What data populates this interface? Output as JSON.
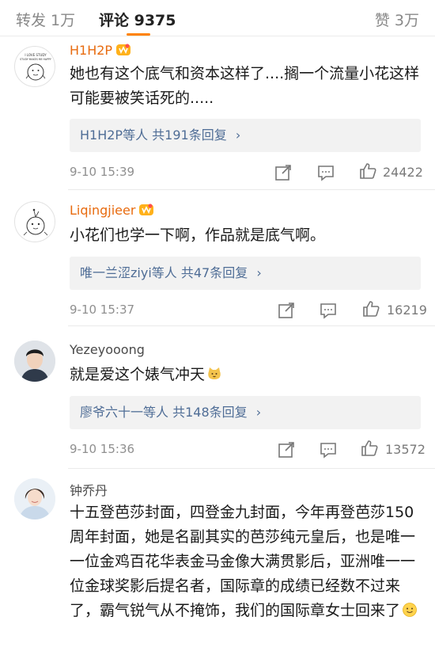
{
  "tabs": {
    "repost": "转发 1万",
    "comments": "评论 9375",
    "likes": "赞 3万"
  },
  "comments": [
    {
      "username": "H1H2P",
      "text": "她也有这个底气和资本这样了....搁一个流量小花这样可能要被笑话死的.....",
      "reply_users": "H1H2P等人",
      "reply_total": "共191条回复",
      "time": "9-10 15:39",
      "likes": "24422"
    },
    {
      "username": "Liqingjieer",
      "text": "小花们也学一下啊，作品就是底气啊。",
      "reply_users": "唯一兰涩ziyi等人",
      "reply_total": "共47条回复",
      "time": "9-10 15:37",
      "likes": "16219"
    },
    {
      "username": "Yezeyooong",
      "text": "就是爱这个婊气冲天",
      "reply_users": "廖爷六十一等人",
      "reply_total": "共148条回复",
      "time": "9-10 15:36",
      "likes": "13572"
    },
    {
      "username": "钟乔丹",
      "text": "十五登芭莎封面，四登金九封面，今年再登芭莎150周年封面，她是名副其实的芭莎纯元皇后，也是唯一一位金鸡百花华表金马金像大满贯影后，亚洲唯一一位金球奖影后提名者，国际章的成绩已经数不过来了，霸气锐气从不掩饰，我们的国际章女士回来了"
    }
  ],
  "avatar_text": {
    "line1": "I LOVE STUDY",
    "line2": "STUDY MAKES ME HAPPY"
  },
  "colors": {
    "accent": "#ff8200",
    "vip_name": "#e86b0f",
    "link": "#4f6d96"
  },
  "icons": {
    "repost": "share-arrow-icon",
    "comment": "chat-bubble-icon",
    "like": "thumbs-up-icon",
    "reply_more": "chevron-right-icon"
  }
}
